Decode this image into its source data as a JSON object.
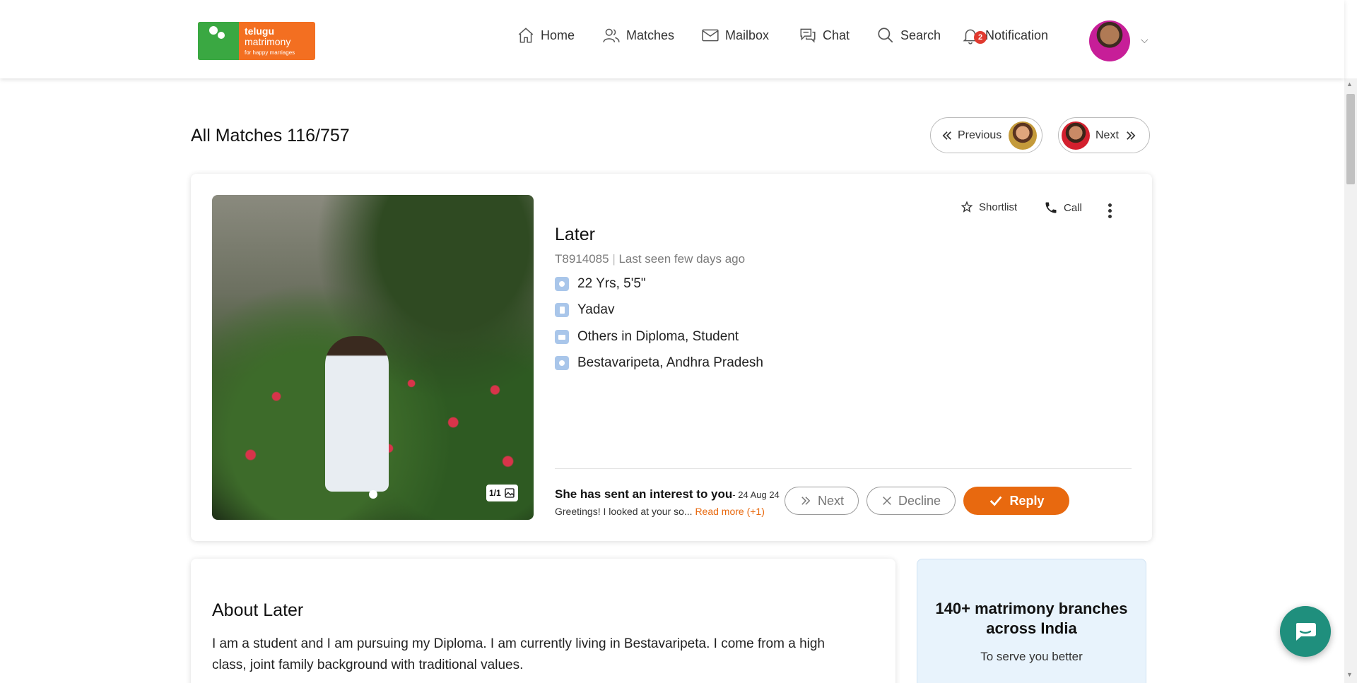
{
  "brand": {
    "line1": "telugu",
    "line2": "matrimony",
    "tagline": "for happy marriages",
    "accent": "#f36f21",
    "leaf": "#3aa842"
  },
  "nav": {
    "items": [
      {
        "label": "Home",
        "icon": "home-icon"
      },
      {
        "label": "Matches",
        "icon": "users-icon"
      },
      {
        "label": "Mailbox",
        "icon": "mail-icon"
      },
      {
        "label": "Chat",
        "icon": "chat-icon"
      },
      {
        "label": "Search",
        "icon": "search-icon"
      },
      {
        "label": "Notification",
        "icon": "bell-icon"
      }
    ],
    "notification_count": "2"
  },
  "page": {
    "title": "All Matches 116/757",
    "previous_label": "Previous",
    "next_label": "Next"
  },
  "profile": {
    "name": "Later",
    "id": "T8914085",
    "last_seen": "Last seen few days ago",
    "age_height": "22 Yrs, 5'5\"",
    "community": "Yadav",
    "education_job": "Others in Diploma, Student",
    "location": "Bestavaripeta, Andhra Pradesh",
    "photo_count": "1/1",
    "shortlist_label": "Shortlist",
    "call_label": "Call"
  },
  "interest": {
    "title": "She has sent an interest to you",
    "date": "- 24 Aug 24",
    "message": "Greetings! I looked at your so...",
    "read_more": "Read more (+1)",
    "next_label": "Next",
    "decline_label": "Decline",
    "reply_label": "Reply"
  },
  "about": {
    "title": "About Later",
    "text": "I am a student and I am pursuing my Diploma. I am currently living in Bestavaripeta. I come from a high class, joint family background with traditional values."
  },
  "branch": {
    "title": "140+ matrimony branches across India",
    "subtitle": "To serve you better"
  },
  "colors": {
    "reply": "#e8690f",
    "chat_fab": "#1f8f7d",
    "icon_bg": "#a9c6ea"
  }
}
